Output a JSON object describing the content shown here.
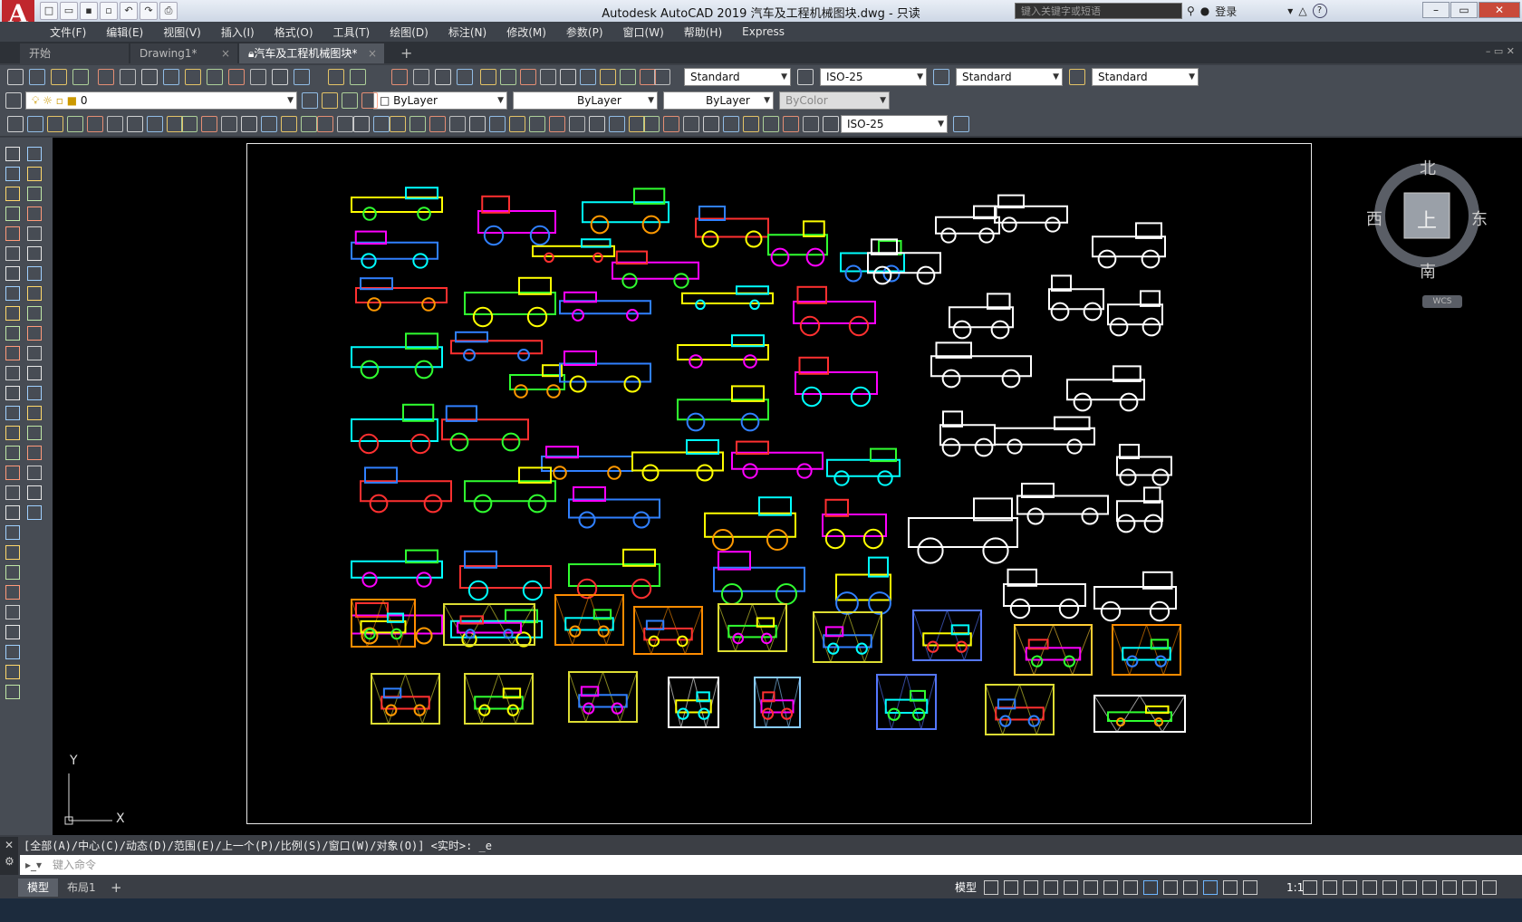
{
  "app": {
    "window_title": "Autodesk AutoCAD 2019    汽车及工程机械图块.dwg - 只读",
    "search_placeholder": "键入关键字或短语",
    "login": "登录",
    "logo_letter": "A"
  },
  "menu": [
    "文件(F)",
    "编辑(E)",
    "视图(V)",
    "插入(I)",
    "格式(O)",
    "工具(T)",
    "绘图(D)",
    "标注(N)",
    "修改(M)",
    "参数(P)",
    "窗口(W)",
    "帮助(H)",
    "Express"
  ],
  "tabs": [
    {
      "label": "开始",
      "close": ""
    },
    {
      "label": "Drawing1*",
      "close": "×"
    },
    {
      "label": "汽车及工程机械图块*",
      "close": "×"
    }
  ],
  "tab_add": "+",
  "styles_toolbar": {
    "text_style": "Standard",
    "dim_style": "ISO-25",
    "table_style": "Standard",
    "mleader_style": "Standard"
  },
  "layers_toolbar": {
    "layer": "0",
    "color": "ByLayer",
    "linetype": "ByLayer",
    "lineweight": "ByLayer",
    "plotstyle": "ByColor"
  },
  "dim_toolbar": {
    "dim_style": "ISO-25"
  },
  "viewcube": {
    "north": "北",
    "south": "南",
    "east": "东",
    "west": "西",
    "face": "上",
    "ucs": "WCS"
  },
  "ucs_icon": {
    "x": "X",
    "y": "Y"
  },
  "command": {
    "history": "[全部(A)/中心(C)/动态(D)/范围(E)/上一个(P)/比例(S)/窗口(W)/对象(O)] <实时>: _e",
    "placeholder": "键入命令"
  },
  "layout_tabs": [
    "模型",
    "布局1"
  ],
  "layout_add": "+",
  "status": {
    "model": "模型",
    "scale": "1:1"
  },
  "colors": {
    "canvas": "#000000",
    "ui_dark": "#474c54",
    "accent_red": "#c0272d"
  }
}
